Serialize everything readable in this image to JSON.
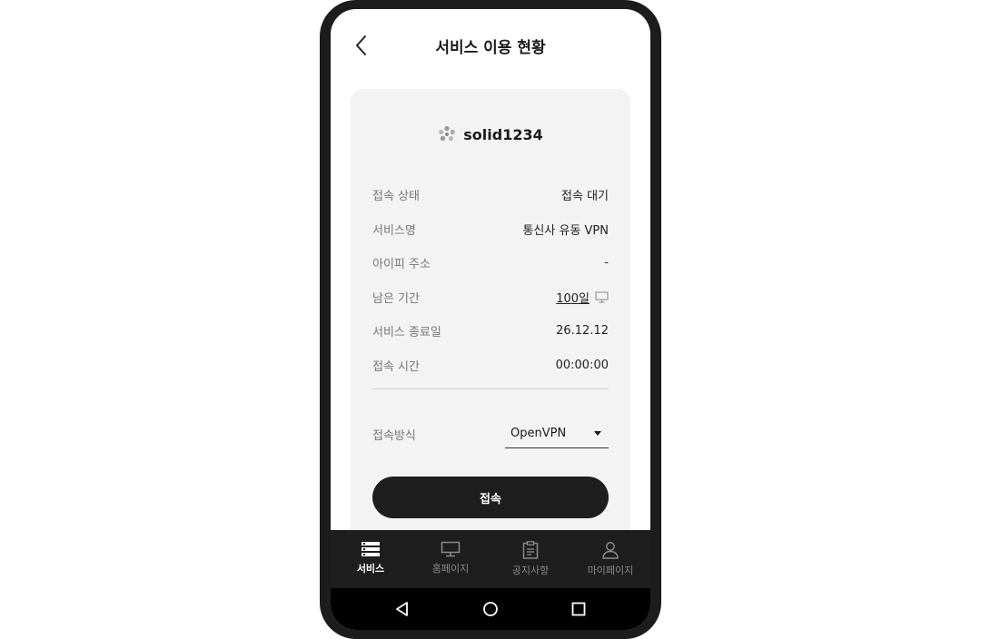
{
  "header": {
    "title": "서비스 이용 현황"
  },
  "account": {
    "name": "solid1234"
  },
  "info": [
    {
      "label": "접속 상태",
      "value": "접속 대기"
    },
    {
      "label": "서비스명",
      "value": "통신사 유동 VPN"
    },
    {
      "label": "아이피 주소",
      "value": "-"
    },
    {
      "label": "남은 기간",
      "value": "100일"
    },
    {
      "label": "서비스 종료일",
      "value": "26.12.12"
    },
    {
      "label": "접속 시간",
      "value": "00:00:00"
    }
  ],
  "method": {
    "label": "접속방식",
    "selected": "OpenVPN"
  },
  "connect_button": "접속",
  "nav": [
    {
      "label": "서비스",
      "icon": "server-icon",
      "active": true
    },
    {
      "label": "홈페이지",
      "icon": "monitor-icon",
      "active": false
    },
    {
      "label": "공지사항",
      "icon": "clipboard-icon",
      "active": false
    },
    {
      "label": "마이페이지",
      "icon": "user-icon",
      "active": false
    }
  ],
  "colors": {
    "accent": "#1e1e1e",
    "card": "#f3f3f3"
  }
}
